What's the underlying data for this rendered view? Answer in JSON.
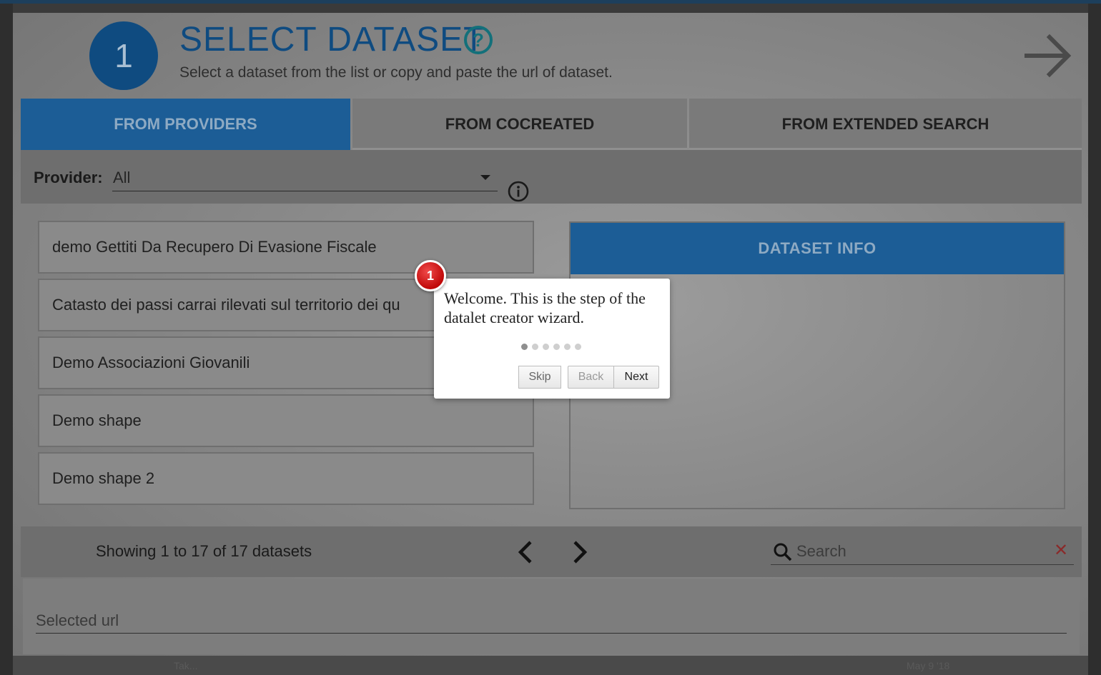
{
  "wizard": {
    "step_number": "1",
    "title": "SELECT DATASET",
    "help_symbol": "?",
    "subtitle": "Select a dataset from the list or copy and paste the url of dataset."
  },
  "tabs": [
    {
      "label": "FROM PROVIDERS",
      "active": true
    },
    {
      "label": "FROM COCREATED",
      "active": false
    },
    {
      "label": "FROM EXTENDED SEARCH",
      "active": false
    }
  ],
  "provider": {
    "label": "Provider:",
    "selected": "All"
  },
  "datasets": [
    "demo Gettiti Da Recupero Di Evasione Fiscale",
    "Catasto dei passi carrai rilevati sul territorio dei qu",
    "Demo Associazioni Giovanili",
    "Demo shape",
    "Demo shape 2"
  ],
  "dataset_info": {
    "header": "DATASET INFO"
  },
  "pagination": {
    "info": "Showing 1 to 17 of 17 datasets"
  },
  "search": {
    "placeholder": "Search",
    "clear_symbol": "✕"
  },
  "selected_url": {
    "placeholder": "Selected url"
  },
  "tour": {
    "badge": "1",
    "text": "Welcome. This is the step of the datalet creator wizard.",
    "dots_total": 6,
    "dot_active": 1,
    "skip_label": "Skip",
    "back_label": "Back",
    "next_label": "Next"
  },
  "background_fragments": {
    "left": "Tak...",
    "date": "May 9 '18"
  },
  "colors": {
    "primary": "#0f4b80",
    "tab_active": "#1c5d96",
    "help": "#13707a",
    "badge": "#d10c0c"
  }
}
